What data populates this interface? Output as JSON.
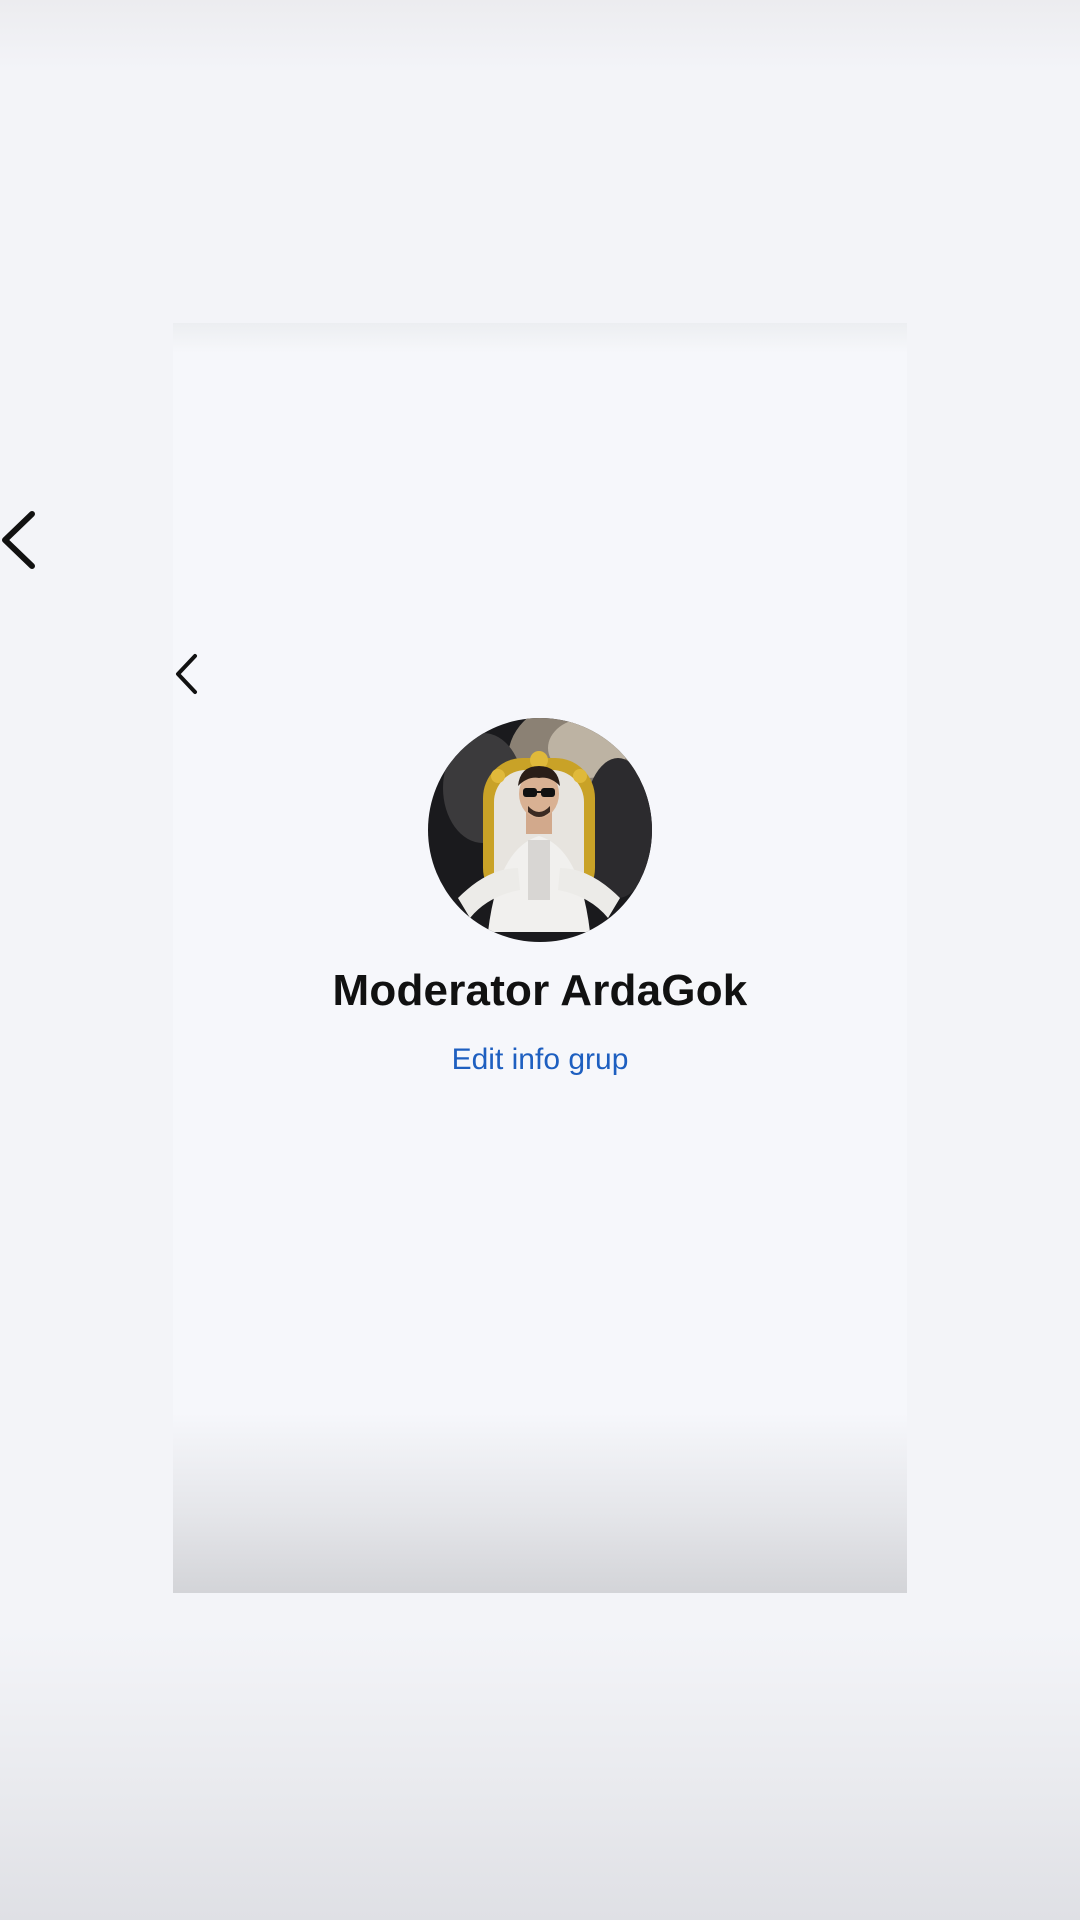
{
  "profile": {
    "group_name": "Moderator ArdaGok",
    "edit_link_label": "Edit info grup",
    "avatar_icon": "group-avatar-photo"
  },
  "navigation": {
    "back_icon": "chevron-left-icon"
  },
  "colors": {
    "background": "#f3f4f8",
    "link": "#1e5fc0",
    "title": "#111111"
  }
}
